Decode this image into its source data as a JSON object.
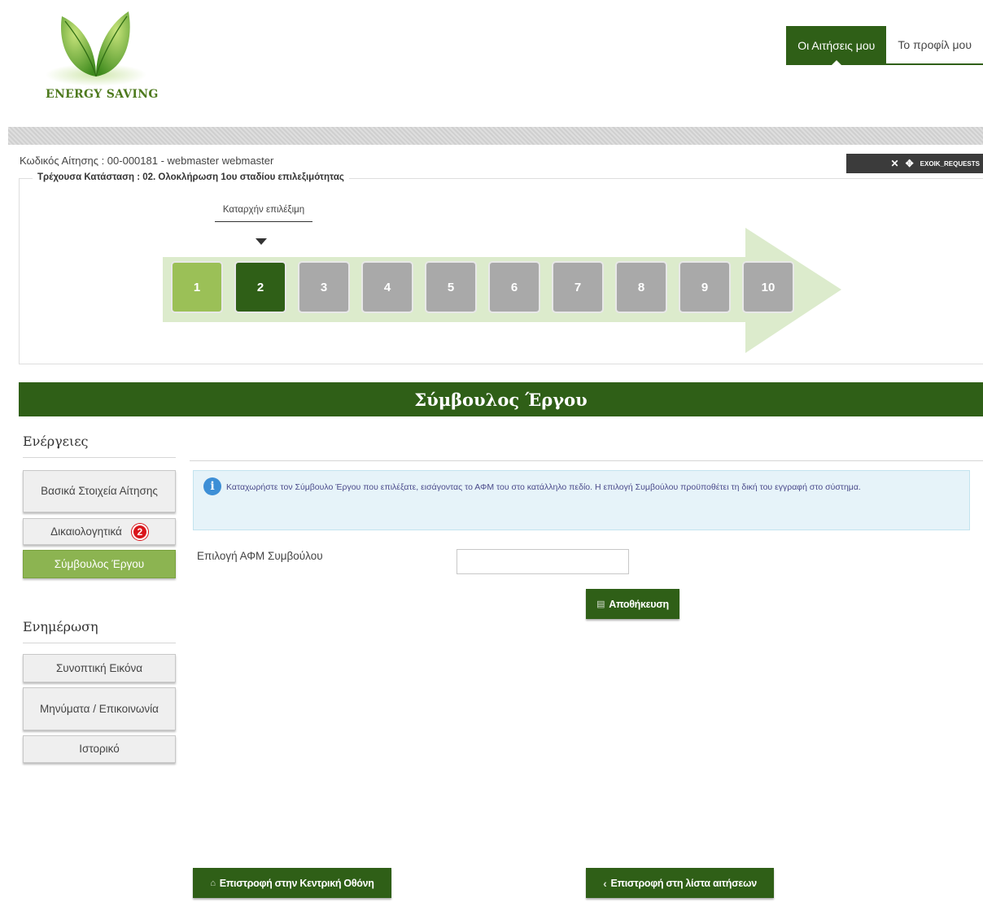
{
  "brand": {
    "name": "ENERGY SAVING"
  },
  "nav": {
    "tabs": [
      {
        "label": "Οι Αιτήσεις μου",
        "active": true
      },
      {
        "label": "Το προφίλ μου",
        "active": false
      }
    ]
  },
  "toolbar": {
    "label": "EXOIK_REQUESTS",
    "close_icon": "close-icon",
    "move_icon": "move-icon"
  },
  "application": {
    "code_line": "Κωδικός Αίτησης : 00-000181 - webmaster webmaster",
    "status_line": "Τρέχουσα Κατάσταση : 02. Ολοκλήρωση 1ου σταδίου επιλεξιμότητας"
  },
  "progress": {
    "current_step": 2,
    "current_label": "Καταρχήν επιλέξιμη",
    "steps": [
      "1",
      "2",
      "3",
      "4",
      "5",
      "6",
      "7",
      "8",
      "9",
      "10"
    ]
  },
  "section": {
    "title": "Σύμβουλος Έργου"
  },
  "sidebar": {
    "actions_title": "Ενέργειες",
    "actions": [
      {
        "label": "Βασικά Στοιχεία Αίτησης",
        "active": false
      },
      {
        "label": "Δικαιολογητικά",
        "badge": "2",
        "active": false
      },
      {
        "label": "Σύμβουλος Έργου",
        "active": true
      }
    ],
    "info_title": "Ενημέρωση",
    "info_items": [
      {
        "label": "Συνοπτική Εικόνα"
      },
      {
        "label": "Μηνύματα / Επικοινωνία"
      },
      {
        "label": "Ιστορικό"
      }
    ]
  },
  "info_message": "Καταχωρήστε τον Σύμβουλο Έργου που επιλέξατε, εισάγοντας το ΑΦΜ του στο κατάλληλο πεδίο. Η επιλογή Συμβούλου προϋποθέτει τη δική του εγγραφή στο σύστημα.",
  "form": {
    "afm_label": "Επιλογή ΑΦΜ Συμβούλου",
    "afm_value": "",
    "save_label": "Αποθήκευση"
  },
  "footer": {
    "home_label": "Επιστροφή στην Κεντρική Οθόνη",
    "list_label": "Επιστροφή στη λίστα αιτήσεων"
  },
  "colors": {
    "brand_green": "#2f5f17",
    "step_done": "#9bc057",
    "step_pending": "#a9a9a9",
    "active_sidebar": "#8cb451",
    "badge_red": "#d9151b"
  }
}
